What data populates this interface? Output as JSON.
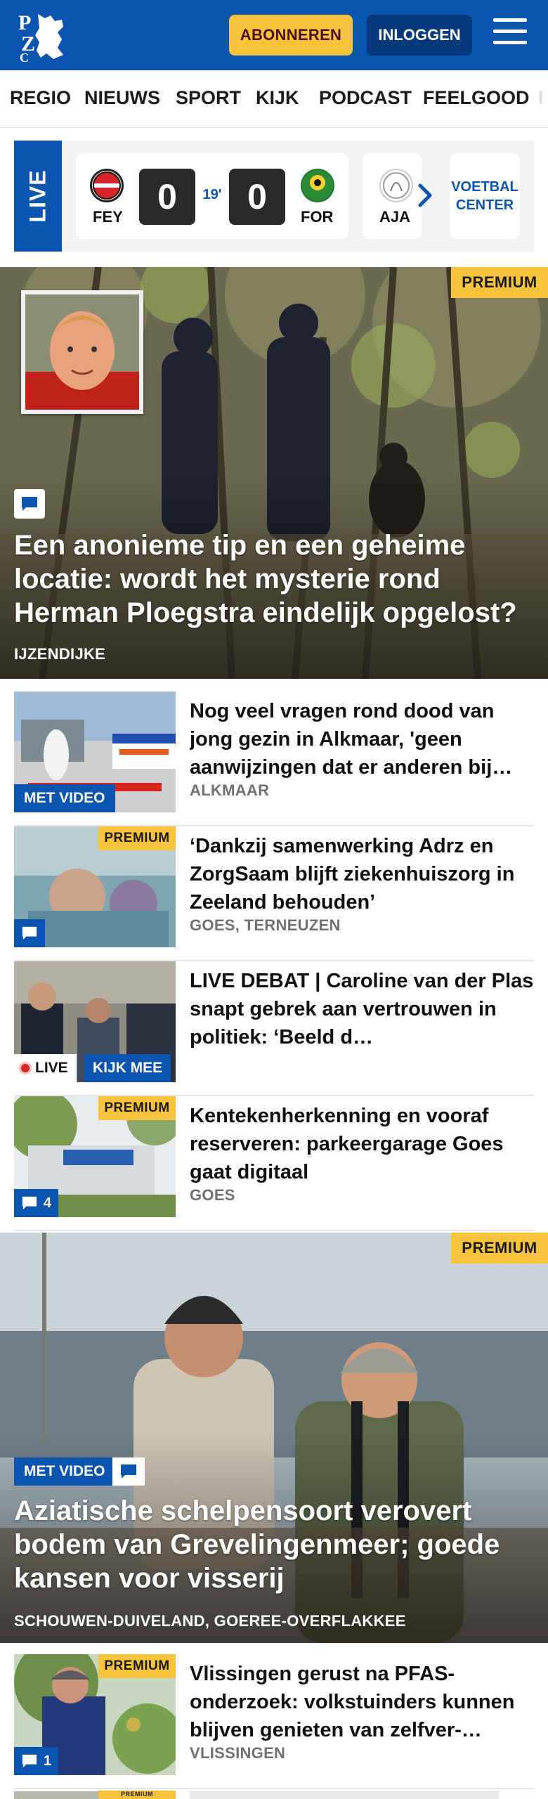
{
  "header": {
    "subscribe_label": "ABONNEREN",
    "login_label": "INLOGGEN",
    "logo_text": "PZC",
    "brand_color": "#0b55b0",
    "accent_color": "#f6c33a"
  },
  "nav": {
    "items": [
      "REGIO",
      "NIEUWS",
      "SPORT",
      "KIJK",
      "PODCAST",
      "FEELGOOD"
    ]
  },
  "live": {
    "label": "LIVE",
    "match": {
      "home_abbr": "FEY",
      "home_score": "0",
      "minute": "19'",
      "away_score": "0",
      "away_abbr": "FOR"
    },
    "next_match_abbr": "AJA",
    "center_label_line1": "VOETBAL",
    "center_label_line2": "CENTER"
  },
  "hero1": {
    "premium_label": "PREMIUM",
    "title": "Een anonieme tip en een geheime locatie: wordt het mysterie rond Herman Ploegstra eindelijk opgelost?",
    "location": "IJZENDIJKE"
  },
  "articles": [
    {
      "title": "Nog veel vragen rond dood van jong gezin in Alkmaar, 'geen aanwijzingen dat er anderen bij…",
      "location": "ALKMAAR",
      "video_label": "MET VIDEO"
    },
    {
      "title": "‘Dankzij samenwerking Adrz en ZorgSaam blijft ziekenhuiszorg in Zeeland behouden’",
      "location": "GOES, TERNEUZEN",
      "premium_label": "PREMIUM"
    },
    {
      "title": "LIVE DEBAT | Caroline van der Plas snapt gebrek aan vertrouwen in politiek: ‘Beeld d…",
      "live_label": "LIVE",
      "watch_label": "KIJK MEE"
    },
    {
      "title": "Kentekenherkenning en vooraf reserveren: parkeergarage Goes gaat digitaal",
      "location": "GOES",
      "premium_label": "PREMIUM",
      "comment_count": "4"
    }
  ],
  "hero2": {
    "premium_label": "PREMIUM",
    "video_label": "MET VIDEO",
    "title": "Aziatische schelpensoort verovert bodem van Grevelingenmeer; goede kansen voor visserij",
    "location": "SCHOUWEN-DUIVELAND, GOEREE-OVERFLAKKEE"
  },
  "article_last": {
    "title": "Vlissingen gerust na PFAS-onderzoek: volkstuinders kunnen blijven genieten van zelfver-…",
    "location": "VLISSINGEN",
    "premium_label": "PREMIUM",
    "comment_count": "1"
  },
  "article_peek": {
    "premium_label": "PREMIUM"
  }
}
